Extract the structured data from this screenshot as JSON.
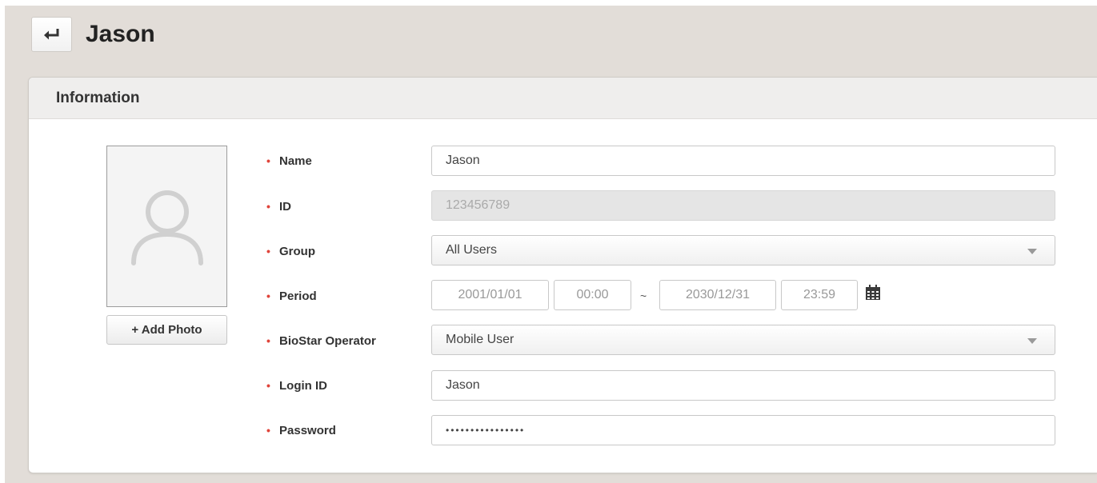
{
  "header": {
    "title": "Jason",
    "back_icon": "return-arrow-icon"
  },
  "panel": {
    "title": "Information"
  },
  "photo": {
    "placeholder_icon": "user-silhouette-icon",
    "add_label": "+ Add Photo"
  },
  "fields": {
    "name": {
      "label": "Name",
      "value": "Jason"
    },
    "id": {
      "label": "ID",
      "value": "123456789"
    },
    "group": {
      "label": "Group",
      "value": "All Users"
    },
    "period": {
      "label": "Period",
      "start_date": "2001/01/01",
      "start_time": "00:00",
      "separator": "~",
      "end_date": "2030/12/31",
      "end_time": "23:59",
      "calendar_icon": "calendar-icon"
    },
    "operator": {
      "label": "BioStar Operator",
      "value": "Mobile User"
    },
    "login_id": {
      "label": "Login ID",
      "value": "Jason"
    },
    "password": {
      "label": "Password",
      "value": "••••••••••••••••"
    }
  },
  "colors": {
    "required_marker": "#e0443a",
    "page_background": "#e2ddd8",
    "panel_header": "#efeeed"
  }
}
